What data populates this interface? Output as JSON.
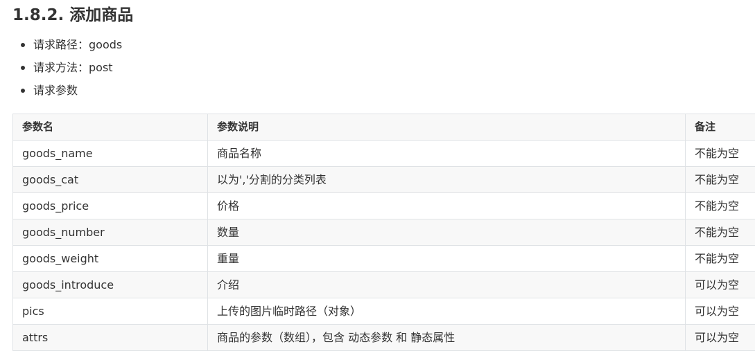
{
  "heading": "1.8.2. 添加商品",
  "bullets": [
    "请求路径：goods",
    "请求方法：post",
    "请求参数"
  ],
  "table": {
    "headers": [
      "参数名",
      "参数说明",
      "备注"
    ],
    "rows": [
      [
        "goods_name",
        "商品名称",
        "不能为空"
      ],
      [
        "goods_cat",
        "以为','分割的分类列表",
        "不能为空"
      ],
      [
        "goods_price",
        "价格",
        "不能为空"
      ],
      [
        "goods_number",
        "数量",
        "不能为空"
      ],
      [
        "goods_weight",
        "重量",
        "不能为空"
      ],
      [
        "goods_introduce",
        "介绍",
        "可以为空"
      ],
      [
        "pics",
        "上传的图片临时路径（对象）",
        "可以为空"
      ],
      [
        "attrs",
        "商品的参数（数组），包含 动态参数 和 静态属性",
        "可以为空"
      ]
    ]
  }
}
